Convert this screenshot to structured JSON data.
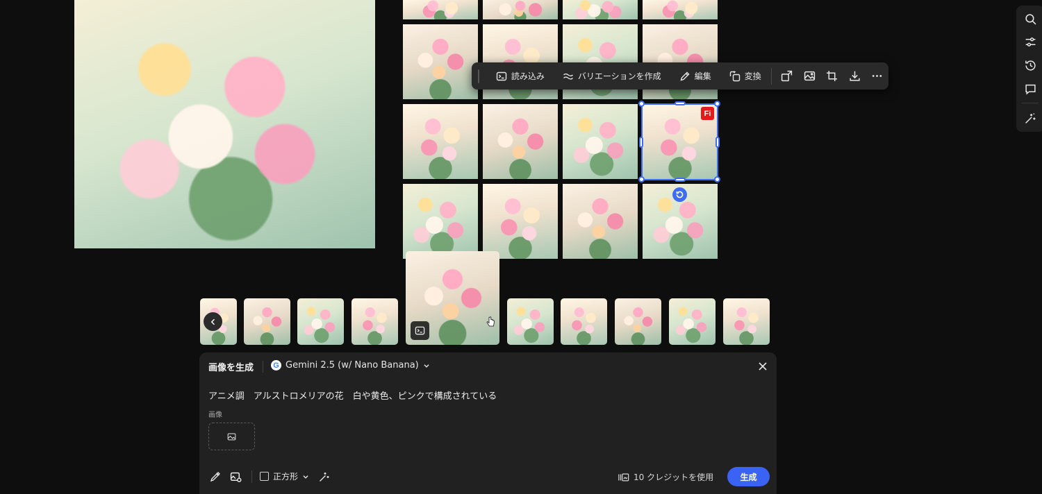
{
  "toolbar": {
    "import_label": "読み込み",
    "variation_label": "バリエーションを作成",
    "edit_label": "編集",
    "convert_label": "変換"
  },
  "selection": {
    "badge": "Fi"
  },
  "panel": {
    "title": "画像を生成",
    "model": "Gemini 2.5 (w/ Nano Banana)",
    "prompt": "アニメ調　アルストロメリアの花　白や黄色、ピンクで構成されている",
    "image_label": "画像",
    "aspect_label": "正方形",
    "credits_label": "10 クレジットを使用",
    "generate_label": "生成"
  },
  "colors": {
    "accent": "#3b63f3",
    "firefly_badge": "#e31b1b",
    "panel_bg": "#212121"
  },
  "icons": {
    "toolbar": [
      "terminal-icon",
      "wave-icon",
      "pencil-icon",
      "transform-icon",
      "upscale-icon",
      "image-icon",
      "crop-icon",
      "download-icon",
      "more-icon"
    ],
    "rail": [
      "search-icon",
      "sliders-icon",
      "history-icon",
      "comment-icon",
      "magic-icon"
    ]
  }
}
